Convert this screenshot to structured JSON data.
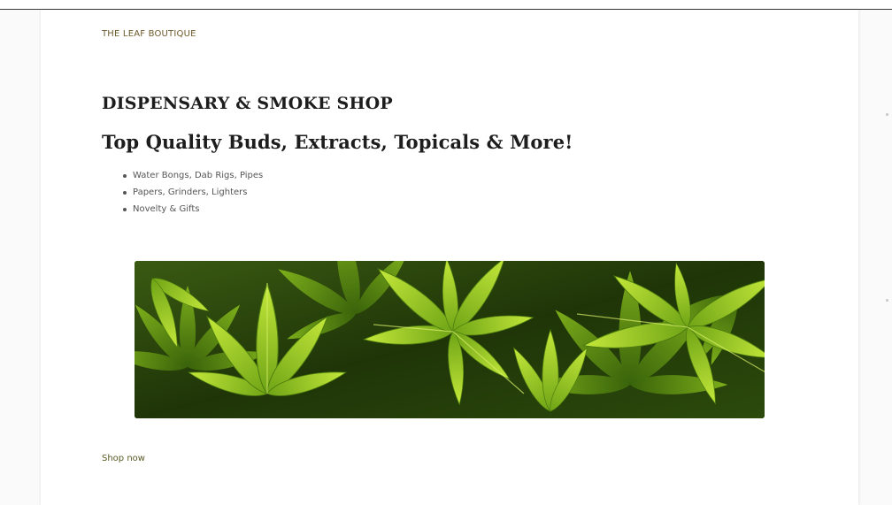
{
  "header": {
    "brand": "THE LEAF BOUTIQUE"
  },
  "main": {
    "heading": "DISPENSARY & SMOKE SHOP",
    "subheading": "Top Quality Buds, Extracts, Topicals & More!",
    "features": [
      "Water Bongs, Dab Rigs, Pipes",
      "Papers, Grinders, Lighters",
      "Novelty & Gifts"
    ],
    "hero_image": "cannabis-leaves-photo",
    "cta": "Shop now"
  },
  "colors": {
    "brand_text": "#6b5a2b",
    "heading_text": "#1d1d1d",
    "body_text": "#555555",
    "leaf_bright": "#9fd022",
    "leaf_dark": "#2e4a0f"
  }
}
